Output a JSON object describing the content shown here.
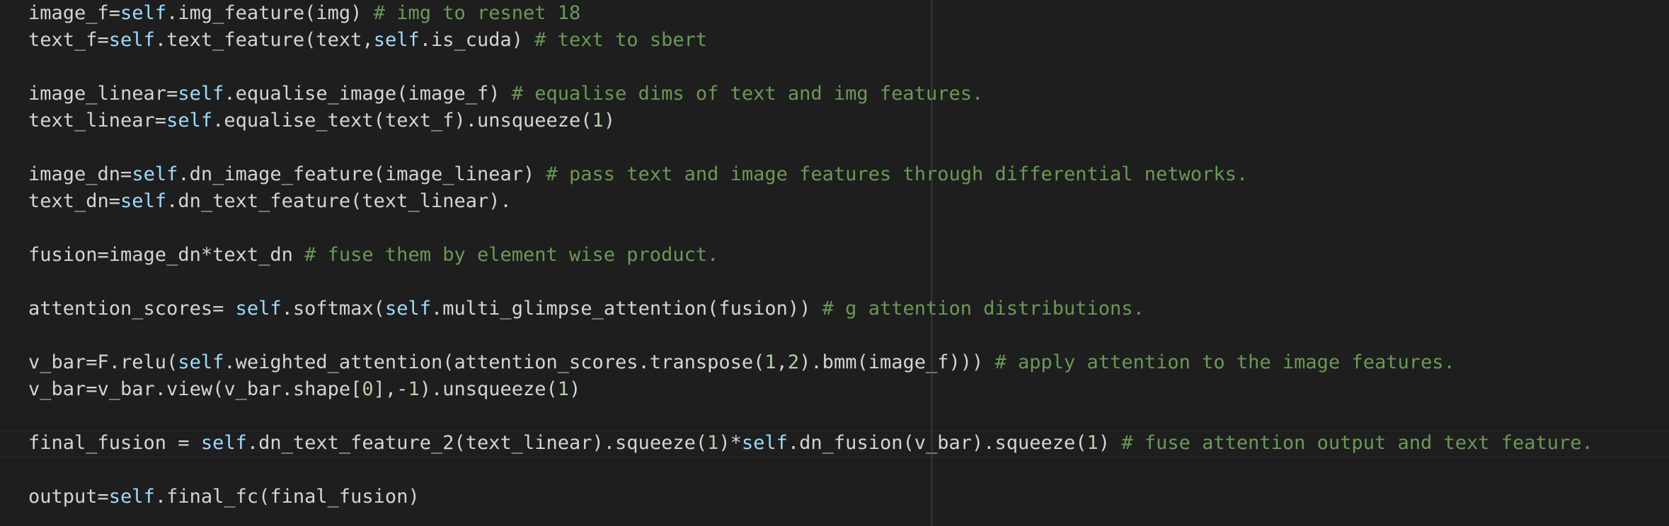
{
  "editor": {
    "lines": [
      [
        {
          "t": "plain",
          "v": "image_f="
        },
        {
          "t": "self",
          "v": "self"
        },
        {
          "t": "plain",
          "v": ".img_feature(img) "
        },
        {
          "t": "comment",
          "v": "# img to resnet 18"
        }
      ],
      [
        {
          "t": "plain",
          "v": "text_f="
        },
        {
          "t": "self",
          "v": "self"
        },
        {
          "t": "plain",
          "v": ".text_feature(text,"
        },
        {
          "t": "self",
          "v": "self"
        },
        {
          "t": "plain",
          "v": ".is_cuda) "
        },
        {
          "t": "comment",
          "v": "# text to sbert"
        }
      ],
      [],
      [
        {
          "t": "plain",
          "v": "image_linear="
        },
        {
          "t": "self",
          "v": "self"
        },
        {
          "t": "plain",
          "v": ".equalise_image(image_f) "
        },
        {
          "t": "comment",
          "v": "# equalise dims of text and img features."
        }
      ],
      [
        {
          "t": "plain",
          "v": "text_linear="
        },
        {
          "t": "self",
          "v": "self"
        },
        {
          "t": "plain",
          "v": ".equalise_text(text_f).unsqueeze("
        },
        {
          "t": "num",
          "v": "1"
        },
        {
          "t": "plain",
          "v": ")"
        }
      ],
      [],
      [
        {
          "t": "plain",
          "v": "image_dn="
        },
        {
          "t": "self",
          "v": "self"
        },
        {
          "t": "plain",
          "v": ".dn_image_feature(image_linear) "
        },
        {
          "t": "comment",
          "v": "# pass text and image features through differential networks."
        }
      ],
      [
        {
          "t": "plain",
          "v": "text_dn="
        },
        {
          "t": "self",
          "v": "self"
        },
        {
          "t": "plain",
          "v": ".dn_text_feature(text_linear)."
        }
      ],
      [],
      [
        {
          "t": "plain",
          "v": "fusion=image_dn*text_dn "
        },
        {
          "t": "comment",
          "v": "# fuse them by element wise product."
        }
      ],
      [],
      [
        {
          "t": "plain",
          "v": "attention_scores= "
        },
        {
          "t": "self",
          "v": "self"
        },
        {
          "t": "plain",
          "v": ".softmax("
        },
        {
          "t": "self",
          "v": "self"
        },
        {
          "t": "plain",
          "v": ".multi_glimpse_attention(fusion)) "
        },
        {
          "t": "comment",
          "v": "# g attention distributions."
        }
      ],
      [],
      [
        {
          "t": "plain",
          "v": "v_bar=F.relu("
        },
        {
          "t": "self",
          "v": "self"
        },
        {
          "t": "plain",
          "v": ".weighted_attention(attention_scores.transpose("
        },
        {
          "t": "num",
          "v": "1"
        },
        {
          "t": "plain",
          "v": ","
        },
        {
          "t": "num",
          "v": "2"
        },
        {
          "t": "plain",
          "v": ").bmm(image_f))) "
        },
        {
          "t": "comment",
          "v": "# apply attention to the image features."
        }
      ],
      [
        {
          "t": "plain",
          "v": "v_bar=v_bar.view(v_bar.shape["
        },
        {
          "t": "num",
          "v": "0"
        },
        {
          "t": "plain",
          "v": "],-"
        },
        {
          "t": "num",
          "v": "1"
        },
        {
          "t": "plain",
          "v": ").unsqueeze("
        },
        {
          "t": "num",
          "v": "1"
        },
        {
          "t": "plain",
          "v": ")"
        }
      ],
      [],
      [
        {
          "t": "plain",
          "v": "final_fusion = "
        },
        {
          "t": "self",
          "v": "self"
        },
        {
          "t": "plain",
          "v": ".dn_text_feature_2(text_linear).squeeze("
        },
        {
          "t": "num",
          "v": "1"
        },
        {
          "t": "plain",
          "v": ")*"
        },
        {
          "t": "self",
          "v": "self"
        },
        {
          "t": "plain",
          "v": ".dn_fusion(v_bar).squeeze("
        },
        {
          "t": "num",
          "v": "1"
        },
        {
          "t": "plain",
          "v": ") "
        },
        {
          "t": "comment",
          "v": "# fuse attention output and text feature."
        }
      ],
      [],
      [
        {
          "t": "plain",
          "v": "output="
        },
        {
          "t": "self",
          "v": "self"
        },
        {
          "t": "plain",
          "v": ".final_fc(final_fusion)"
        }
      ]
    ],
    "colors": {
      "background": "#1e1e1e",
      "plain": "#d4d4d4",
      "self": "#9cdcfe",
      "comment": "#6a9955",
      "number": "#b5cea8",
      "ruler": "#4a4a4a"
    }
  }
}
